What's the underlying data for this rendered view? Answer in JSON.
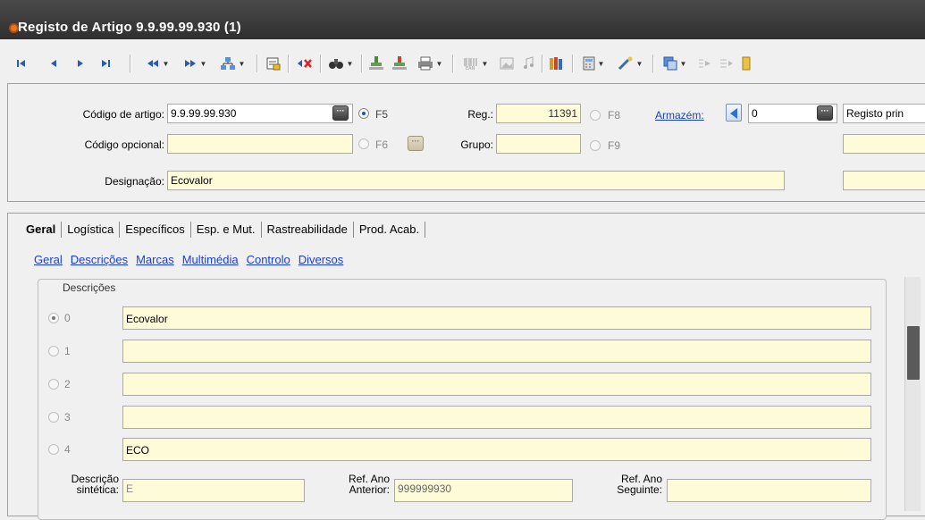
{
  "window": {
    "title": "Registo de Artigo 9.9.99.99.930 (1)"
  },
  "header": {
    "codigo_artigo": {
      "label": "Código de artigo:",
      "value": "9.9.99.99.930",
      "radio_key": "F5"
    },
    "codigo_opcional": {
      "label": "Código opcional:",
      "value": "",
      "radio_key": "F6"
    },
    "designacao": {
      "label": "Designação:",
      "value": "Ecovalor"
    },
    "reg": {
      "label": "Reg.:",
      "value": "11391",
      "radio_key": "F8"
    },
    "grupo": {
      "label": "Grupo:",
      "value": "",
      "radio_key": "F9"
    },
    "armazem": {
      "label": "Armazém:",
      "value": "0",
      "desc": "Registo prin"
    }
  },
  "tabs": [
    "Geral",
    "Logística",
    "Específicos",
    "Esp. e Mut.",
    "Rastreabilidade",
    "Prod. Acab."
  ],
  "active_tab": "Geral",
  "subtabs": [
    "Geral",
    "Descrições",
    "Marcas",
    "Multimédia",
    "Controlo",
    "Diversos"
  ],
  "descricoes": {
    "title": "Descrições",
    "rows": [
      {
        "index": "0",
        "value": "Ecovalor",
        "selected": true
      },
      {
        "index": "1",
        "value": "",
        "selected": false
      },
      {
        "index": "2",
        "value": "",
        "selected": false
      },
      {
        "index": "3",
        "value": "",
        "selected": false
      },
      {
        "index": "4",
        "value": "ECO",
        "selected": false
      }
    ],
    "descricao_sintetica": {
      "label_1": "Descrição",
      "label_2": "sintética:",
      "value": "E"
    },
    "ref_ano_anterior": {
      "label_1": "Ref. Ano",
      "label_2": "Anterior:",
      "value": "999999930"
    },
    "ref_ano_seguinte": {
      "label_1": "Ref. Ano",
      "label_2": "Seguinte:",
      "value": ""
    }
  },
  "icons": {
    "first": "first-record-icon",
    "prev": "previous-record-icon",
    "next": "next-record-icon",
    "last": "last-record-icon",
    "rewind": "rewind-icon",
    "forward": "fast-forward-icon",
    "tree": "hierarchy-icon",
    "filter": "filter-icon",
    "delete": "delete-icon",
    "search": "binoculars-icon",
    "stamp": "stamp-icon",
    "stamp2": "stamp-alt-icon",
    "print": "printer-icon",
    "barcode": "barcode-icon",
    "image": "image-icon",
    "music": "music-icon",
    "books": "books-icon",
    "calculator": "calculator-icon",
    "wand": "wizard-icon",
    "copy": "copy-icon",
    "arrow1": "arrow-in-icon",
    "arrow2": "arrow-out-icon",
    "door": "exit-icon"
  },
  "colors": {
    "titlebar": "#3a3a3a",
    "field_bg": "#fdfbd8",
    "link": "#1b43b6"
  }
}
